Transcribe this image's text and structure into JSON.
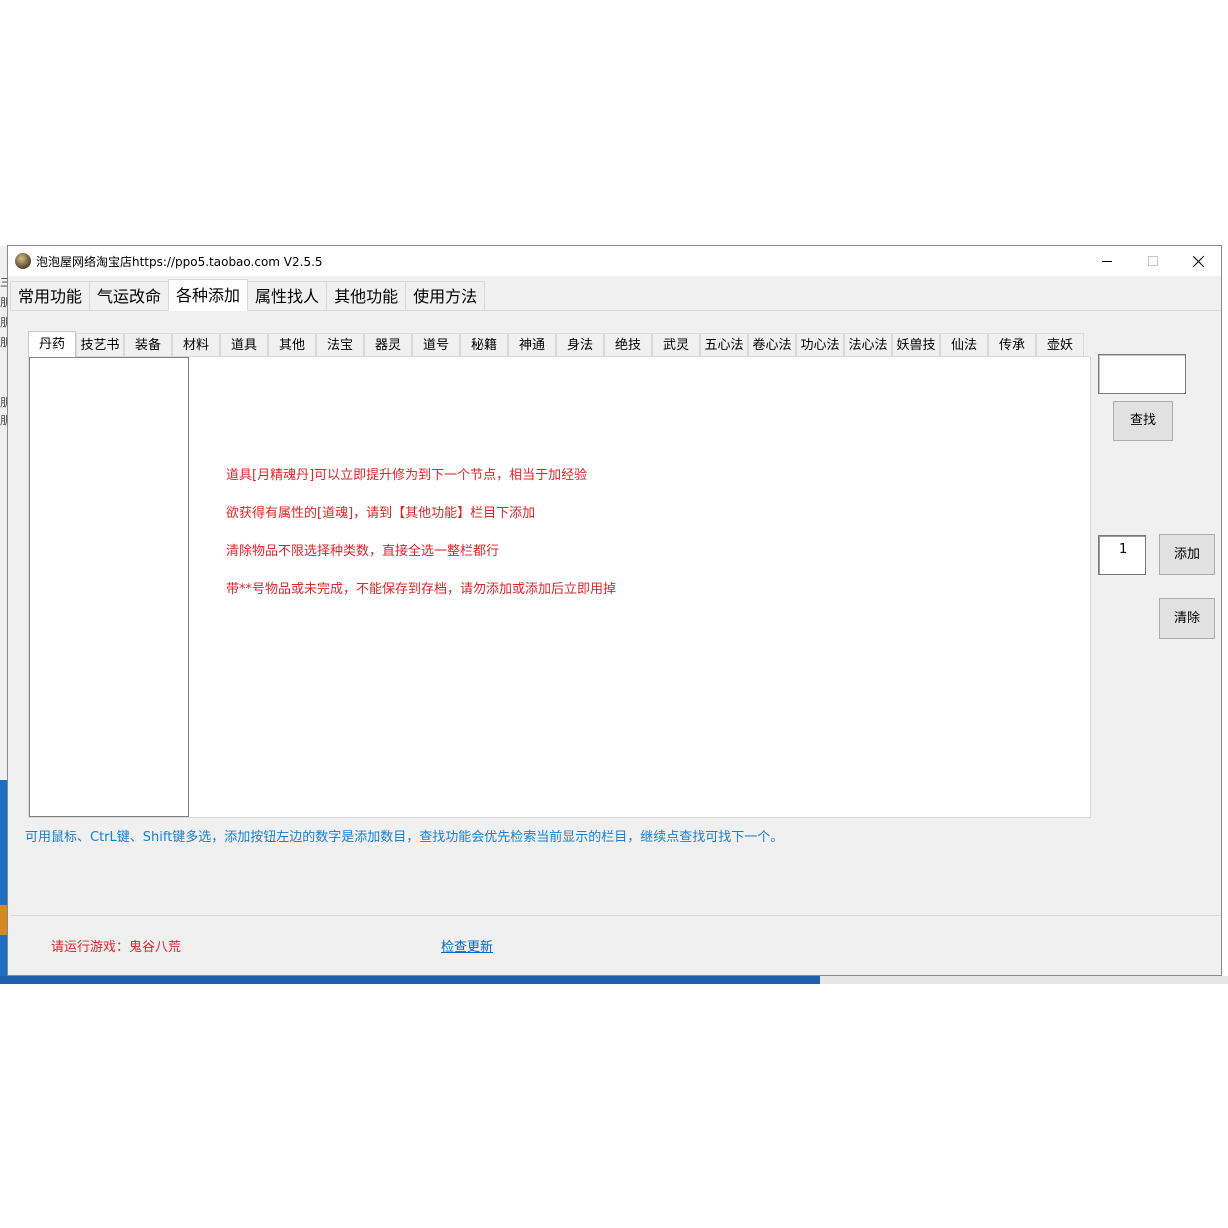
{
  "window": {
    "title": "泡泡屋网络淘宝店https://ppo5.taobao.com   V2.5.5"
  },
  "main_tabs": [
    {
      "label": "常用功能",
      "active": false
    },
    {
      "label": "气运改命",
      "active": false
    },
    {
      "label": "各种添加",
      "active": true
    },
    {
      "label": "属性找人",
      "active": false
    },
    {
      "label": "其他功能",
      "active": false
    },
    {
      "label": "使用方法",
      "active": false
    }
  ],
  "sub_tabs": [
    {
      "label": "丹药",
      "active": true
    },
    {
      "label": "技艺书"
    },
    {
      "label": "装备"
    },
    {
      "label": "材料"
    },
    {
      "label": "道具"
    },
    {
      "label": "其他"
    },
    {
      "label": "法宝"
    },
    {
      "label": "器灵"
    },
    {
      "label": "道号"
    },
    {
      "label": "秘籍"
    },
    {
      "label": "神通"
    },
    {
      "label": "身法"
    },
    {
      "label": "绝技"
    },
    {
      "label": "武灵"
    },
    {
      "label": "五心法"
    },
    {
      "label": "卷心法"
    },
    {
      "label": "功心法"
    },
    {
      "label": "法心法"
    },
    {
      "label": "妖兽技"
    },
    {
      "label": "仙法"
    },
    {
      "label": "传承"
    },
    {
      "label": "壶妖"
    }
  ],
  "info_lines": [
    "道具[月精魂丹]可以立即提升修为到下一个节点，相当于加经验",
    "欲获得有属性的[道魂]，请到【其他功能】栏目下添加",
    "清除物品不限选择种类数，直接全选一整栏都行",
    "带**号物品或未完成，不能保存到存档，请勿添加或添加后立即用掉"
  ],
  "controls": {
    "search_value": "",
    "search_button": "查找",
    "quantity_value": "1",
    "add_button": "添加",
    "clear_button": "清除"
  },
  "hint": "可用鼠标、CtrL键、Shift键多选，添加按钮左边的数字是添加数目，查找功能会优先检索当前显示的栏目，继续点查找可找下一个。",
  "status": {
    "game_prompt": "请运行游戏：鬼谷八荒",
    "update_link": "检查更新"
  },
  "colors": {
    "info_red": "#e0262b",
    "hint_blue": "#1a7fd0",
    "link_blue": "#0a66c2",
    "window_bg": "#f0f0f0"
  },
  "icons": {
    "app": "app-logo-icon",
    "minimize": "minimize-icon",
    "maximize": "maximize-icon",
    "close": "close-icon"
  }
}
